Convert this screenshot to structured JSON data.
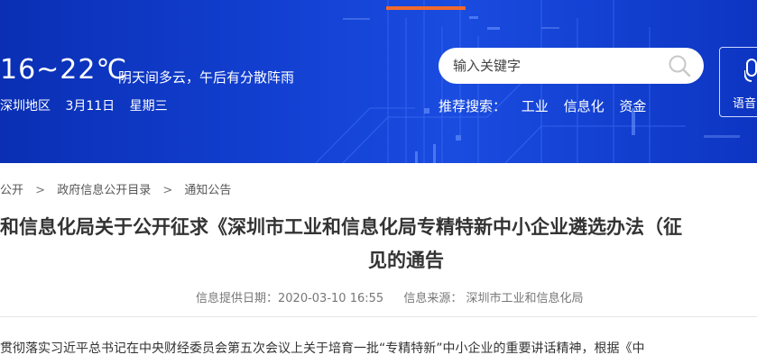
{
  "header": {
    "temperature": "16~22℃",
    "weather": "阴天间多云，午后有分散阵雨",
    "region": "深圳地区",
    "date": "3月11日",
    "weekday": "星期三",
    "search_placeholder": "输入关键字",
    "recommend_label": "推荐搜索：",
    "recommend_keywords": [
      "工业",
      "信息化",
      "资金"
    ],
    "voice_label": "语音"
  },
  "breadcrumb": {
    "items": [
      "公开",
      "政府信息公开目录",
      "通知公告"
    ],
    "separator": ">"
  },
  "article": {
    "title_line1": "和信息化局关于公开征求《深圳市工业和信息化局专精特新中小企业遴选办法（征",
    "title_line2": "见的通告",
    "date_label": "信息提供日期：",
    "date_value": "2020-03-10 16:55",
    "source_label": "信息来源：",
    "source_value": "深圳市工业和信息化局",
    "body_start": "贯彻落实习近平总书记在中央财经委员会第五次会议上关于培育一批“专精特新”中小企业的重要讲话精神，根据《中"
  },
  "colors": {
    "banner": "#123fd0",
    "accent": "#f36a2b",
    "text": "#333333",
    "meta_text": "#777777"
  }
}
